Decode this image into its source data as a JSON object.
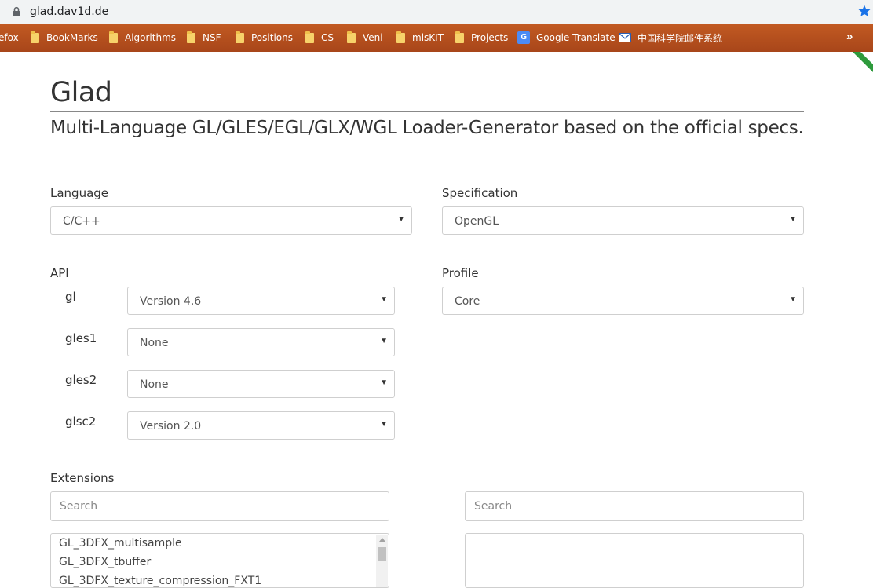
{
  "browser": {
    "url": "glad.dav1d.de",
    "bookmarks": [
      {
        "label": "efox",
        "icon": "none"
      },
      {
        "label": "BookMarks",
        "icon": "folder-icon"
      },
      {
        "label": "Algorithms",
        "icon": "folder-icon"
      },
      {
        "label": "NSF",
        "icon": "folder-icon"
      },
      {
        "label": "Positions",
        "icon": "folder-icon"
      },
      {
        "label": "CS",
        "icon": "folder-icon"
      },
      {
        "label": "Veni",
        "icon": "folder-icon"
      },
      {
        "label": "mlsKIT",
        "icon": "folder-icon"
      },
      {
        "label": "Projects",
        "icon": "folder-icon"
      },
      {
        "label": "Google Translate",
        "icon": "google-translate-icon"
      },
      {
        "label": "中国科学院邮件系统",
        "icon": "mail-icon"
      }
    ],
    "more": "»",
    "colors": {
      "bookmark_bar": "#b04e1e",
      "url_bar": "#f1f3f4",
      "star": "#1a73e8"
    }
  },
  "page": {
    "title": "Glad",
    "subtitle": "Multi-Language GL/GLES/EGL/GLX/WGL Loader-Generator based on the official specs."
  },
  "form": {
    "language": {
      "label": "Language",
      "value": "C/C++"
    },
    "specification": {
      "label": "Specification",
      "value": "OpenGL"
    },
    "api": {
      "label": "API",
      "rows": [
        {
          "name": "gl",
          "value": "Version 4.6"
        },
        {
          "name": "gles1",
          "value": "None"
        },
        {
          "name": "gles2",
          "value": "None"
        },
        {
          "name": "glsc2",
          "value": "Version 2.0"
        }
      ]
    },
    "profile": {
      "label": "Profile",
      "value": "Core"
    },
    "extensions": {
      "label": "Extensions",
      "search_left_placeholder": "Search",
      "search_right_placeholder": "Search",
      "available": [
        "GL_3DFX_multisample",
        "GL_3DFX_tbuffer",
        "GL_3DFX_texture_compression_FXT1"
      ],
      "selected": []
    }
  }
}
